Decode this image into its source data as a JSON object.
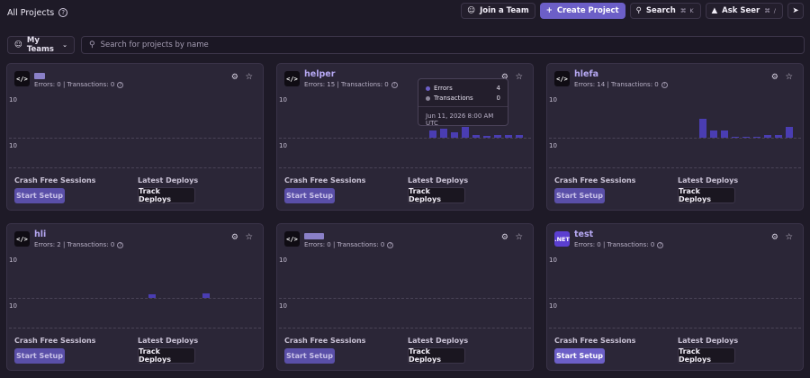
{
  "header": {
    "title": "All Projects",
    "join_team": "Join a Team",
    "create_project": "Create Project",
    "search": "Search",
    "search_shortcut": "⌘ K",
    "ask_seer": "Ask Seer",
    "ask_seer_shortcut": "⌘ /"
  },
  "filters": {
    "team_label": "My Teams",
    "search_placeholder": "Search for projects by name"
  },
  "colors": {
    "accent": "#6c5fc7",
    "bar": "#4a3db2",
    "errors_dot": "#6c5fc7",
    "transactions_dot": "#8c8799"
  },
  "icons": [
    "help-icon",
    "user-icon",
    "plus-icon",
    "search-icon",
    "sparkle-icon",
    "megaphone-icon",
    "chevron-down-icon",
    "gear-icon",
    "star-icon",
    "code-icon"
  ],
  "labels": {
    "crash_free": "Crash Free Sessions",
    "latest_deploys": "Latest Deploys",
    "start_setup": "Start Setup",
    "track_deploys": "Track Deploys",
    "axis_top": "10",
    "axis_mid": "10"
  },
  "projects": [
    {
      "name": "",
      "stats": "Errors: 0 | Transactions: 0",
      "platform": "</>",
      "bars": [],
      "setup_active": false
    },
    {
      "name": "helper",
      "stats": "Errors: 15 | Transactions: 0",
      "platform": "</>",
      "bars": [
        0,
        0,
        0,
        0,
        0,
        0,
        0,
        0,
        0,
        0,
        0,
        0,
        0,
        0,
        0,
        0,
        0,
        0,
        0,
        0,
        0,
        0,
        0,
        0,
        0,
        0,
        0,
        0,
        0,
        0,
        0,
        0,
        0,
        0,
        0,
        0,
        0,
        0,
        0,
        0,
        0,
        0,
        0,
        0,
        0,
        0,
        0,
        0,
        0,
        0,
        0,
        0,
        0,
        0,
        0,
        0,
        1.5,
        2,
        2.5,
        1.5,
        2,
        0.5,
        0.5,
        0.5,
        0.5,
        0.5,
        0.5,
        0.5
      ],
      "setup_active": false
    },
    {
      "name": "hlefa",
      "stats": "Errors: 14 | Transactions: 0",
      "platform": "</>",
      "bars": [],
      "setup_active": false
    },
    {
      "name": "hli",
      "stats": "Errors: 2 | Transactions: 0",
      "platform": "</>",
      "bars": [],
      "setup_active": false
    },
    {
      "name": "",
      "stats": "Errors: 0 | Transactions: 0",
      "platform": "</>",
      "bars": [],
      "setup_active": false
    },
    {
      "name": "test",
      "stats": "Errors: 0 | Transactions: 0",
      "platform": ".NET",
      "bars": [],
      "setup_active": true
    }
  ],
  "tooltip": {
    "errors_label": "Errors",
    "errors_value": "4",
    "transactions_label": "Transactions",
    "transactions_value": "0",
    "date": "Jun 11, 2026 8:00 AM UTC"
  }
}
